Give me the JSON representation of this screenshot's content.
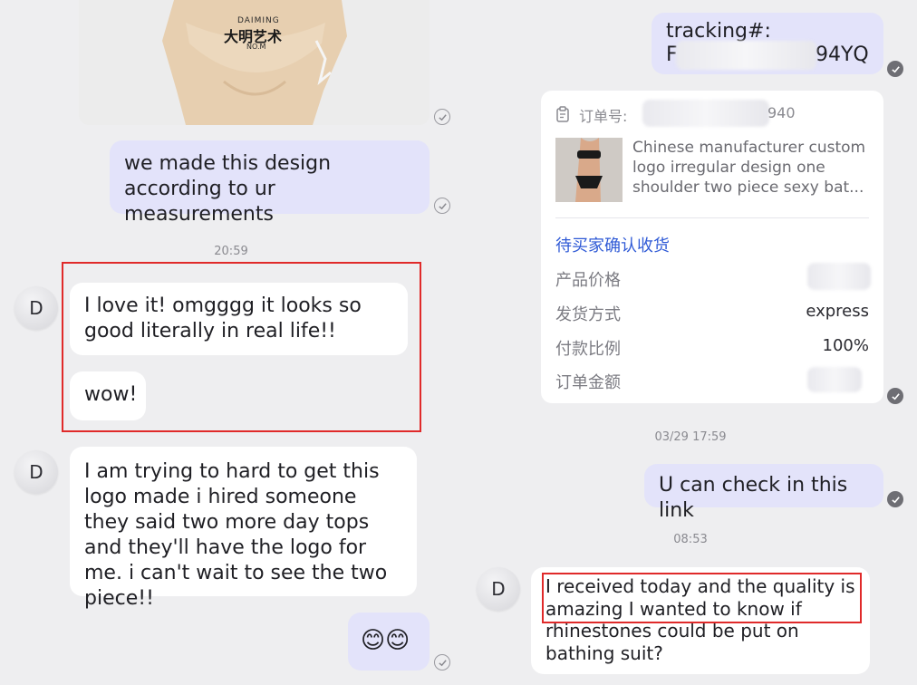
{
  "left": {
    "photo": {
      "logo_top": "DAIMING",
      "logo_main": "大明艺术",
      "logo_bottom": "NO.M"
    },
    "msg_design": "we made this design according to ur measurements",
    "time_1": "20:59",
    "avatar_letter": "D",
    "msg_love": "I love it! omgggg it looks so good literally in real life!!",
    "msg_wow": "wow!",
    "msg_trying": "I am trying to hard to get this logo made i hired someone they said two more day tops and they'll have the logo for me. i can't wait to see the two piece!!",
    "msg_emoji": "😊😊"
  },
  "right": {
    "tracking_label": "tracking#:",
    "tracking_prefix": "F",
    "tracking_suffix": "94YQ",
    "order": {
      "order_no_label": "订单号:",
      "order_no_suffix": "940",
      "product_title": "Chinese manufacturer custom logo irregular design one shoulder two piece sexy bat...",
      "status": "待买家确认收货",
      "rows": [
        {
          "label": "产品价格",
          "value": ""
        },
        {
          "label": "发货方式",
          "value": "express"
        },
        {
          "label": "付款比例",
          "value": "100%"
        },
        {
          "label": "订单金额",
          "value": ""
        }
      ]
    },
    "time_2": "03/29 17:59",
    "msg_link": "U can check in this link",
    "time_3": "08:53",
    "avatar_letter": "D",
    "msg_received": "I received today and the quality is amazing I wanted to know if rhinestones could be put on bathing suit?"
  },
  "colors": {
    "outgoing_bubble": "#e3e3fa",
    "incoming_bubble": "#ffffff",
    "background": "#eeeef0",
    "highlight_box": "#e02a2a",
    "status_link": "#2f5ad6"
  },
  "icons": [
    "read-check-icon",
    "order-clipboard-icon",
    "avatar"
  ]
}
